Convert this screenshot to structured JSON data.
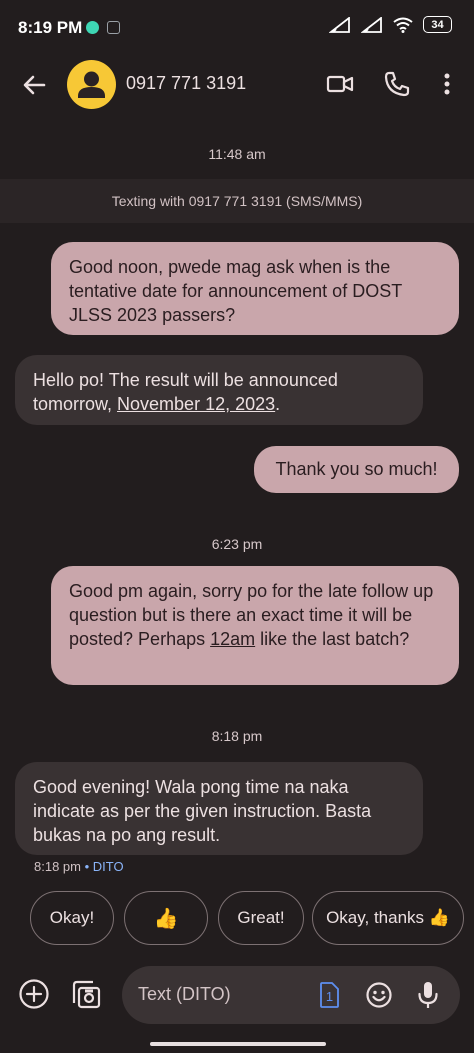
{
  "status_bar": {
    "time": "8:19 PM",
    "battery": "34",
    "icons": [
      "messenger-notification-icon",
      "screenshot-notification-icon",
      "signal-icon",
      "signal-icon",
      "wifi-icon",
      "battery-icon"
    ]
  },
  "header": {
    "contact": "0917 771 3191",
    "icons": [
      "back-arrow-icon",
      "avatar-person-icon",
      "video-call-icon",
      "phone-icon",
      "more-vert-icon"
    ]
  },
  "conversation": {
    "banner": "Texting with 0917 771 3191 (SMS/MMS)",
    "timestamps": [
      "11:48 am",
      "6:23 pm",
      "8:18 pm"
    ],
    "messages": [
      {
        "dir": "out",
        "text": "Good noon, pwede mag ask when is the tentative date for announcement of DOST JLSS 2023 passers?"
      },
      {
        "dir": "in",
        "pre": "Hello po! The result will be announced tomorrow, ",
        "link": "November 12, 2023",
        "post": "."
      },
      {
        "dir": "out",
        "text": "Thank you so much!"
      },
      {
        "dir": "out",
        "pre": "Good pm again, sorry po for the late follow up question but is there an exact time it will be posted? Perhaps ",
        "link": "12am",
        "post": " like the last batch?"
      },
      {
        "dir": "in",
        "text": "Good evening! Wala pong time na naka indicate as per the given instruction. Basta bukas na po ang result."
      }
    ],
    "last_meta": {
      "time": "8:18 pm",
      "separator": "•",
      "carrier": "DITO"
    }
  },
  "smart_replies": [
    "Okay!",
    "👍",
    "Great!",
    "Okay, thanks 👍"
  ],
  "composer": {
    "placeholder": "Text (DITO)",
    "sim": "1",
    "icons": [
      "add-icon",
      "gallery-icon",
      "sim-icon",
      "emoji-icon",
      "mic-icon"
    ]
  },
  "colors": {
    "background": "#221d1e",
    "outgoing_bubble": "#c9a6ab",
    "incoming_bubble": "#393233",
    "avatar": "#f7c836",
    "carrier_link": "#8ab4f8"
  }
}
